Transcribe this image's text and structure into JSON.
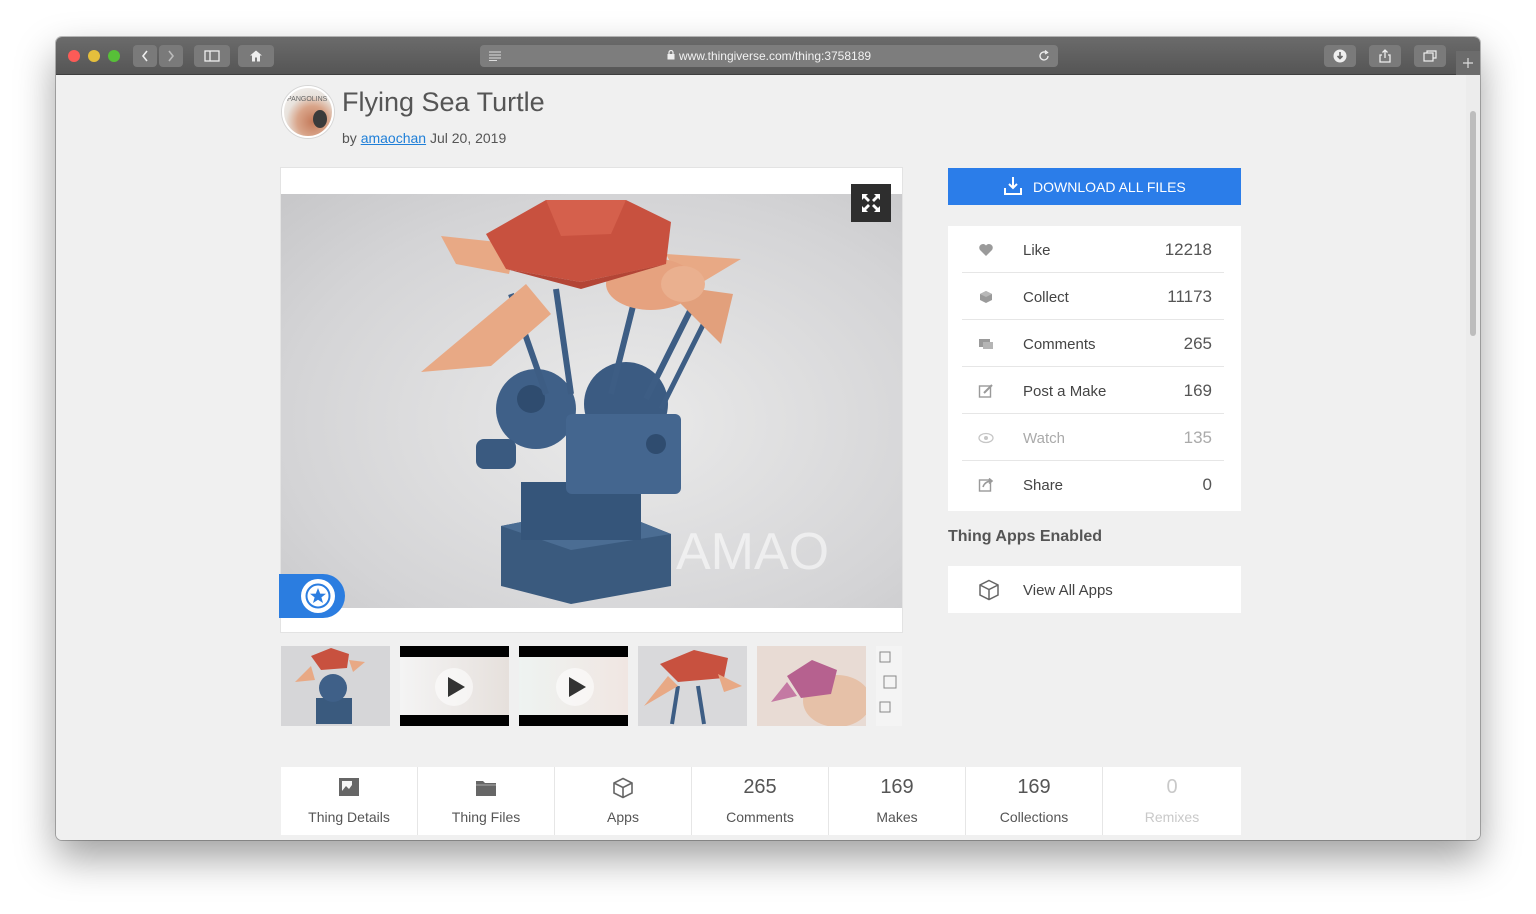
{
  "browser": {
    "url": "www.thingiverse.com/thing:3758189"
  },
  "thing": {
    "title": "Flying Sea Turtle",
    "by_prefix": "by",
    "author": "amaochan",
    "date": "Jul 20, 2019",
    "avatar_text": "PANGOLINS",
    "watermark": "AMAO"
  },
  "actions": {
    "download_label": "DOWNLOAD ALL FILES"
  },
  "stats": [
    {
      "label": "Like",
      "count": "12218",
      "icon": "heart-icon"
    },
    {
      "label": "Collect",
      "count": "11173",
      "icon": "collect-icon"
    },
    {
      "label": "Comments",
      "count": "265",
      "icon": "comment-icon"
    },
    {
      "label": "Post a Make",
      "count": "169",
      "icon": "edit-icon"
    },
    {
      "label": "Watch",
      "count": "135",
      "icon": "eye-icon"
    },
    {
      "label": "Share",
      "count": "0",
      "icon": "share-icon"
    }
  ],
  "apps": {
    "heading": "Thing Apps Enabled",
    "view_all": "View All Apps"
  },
  "tabs": [
    {
      "label": "Thing Details",
      "icon": "details-icon"
    },
    {
      "label": "Thing Files",
      "icon": "folder-icon"
    },
    {
      "label": "Apps",
      "icon": "cube-icon"
    },
    {
      "label": "Comments",
      "count": "265"
    },
    {
      "label": "Makes",
      "count": "169"
    },
    {
      "label": "Collections",
      "count": "169"
    },
    {
      "label": "Remixes",
      "count": "0"
    }
  ],
  "colors": {
    "accent": "#2b7de9",
    "link": "#1f7fd8",
    "turtle_shell": "#c8513f",
    "turtle_body": "#e8a985",
    "stand": "#3e5e82"
  }
}
